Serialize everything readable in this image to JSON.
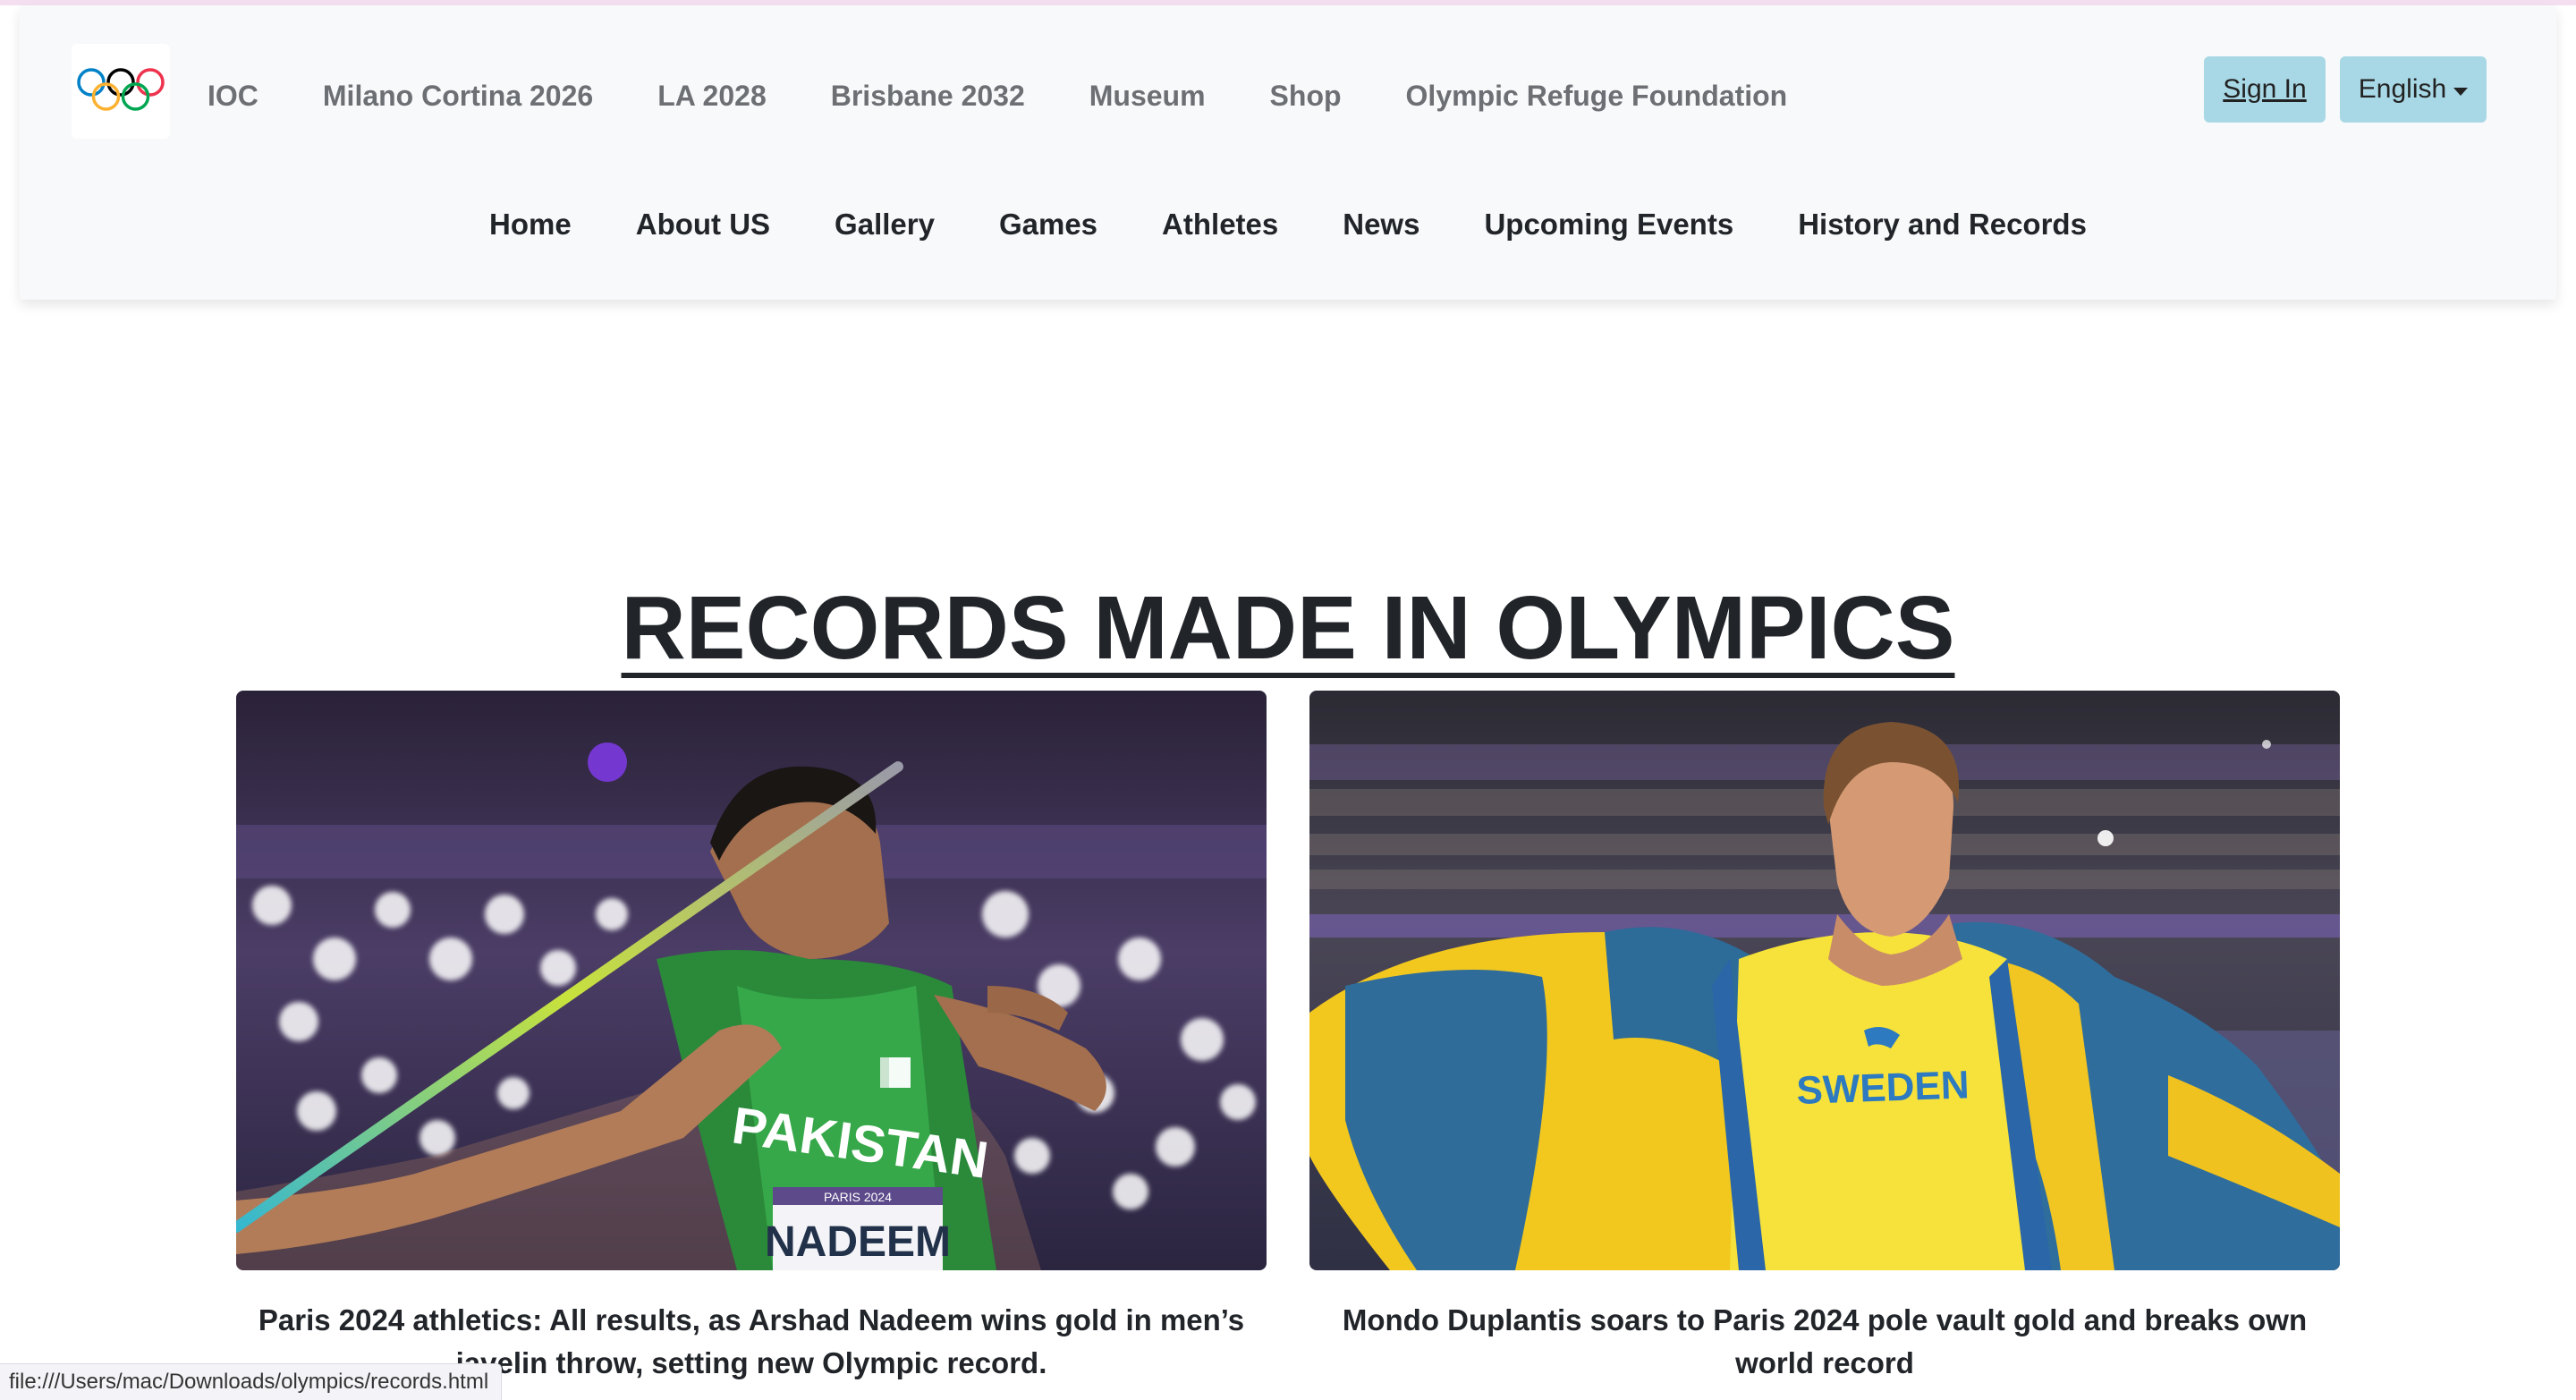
{
  "top_nav": {
    "items": [
      {
        "label": "IOC"
      },
      {
        "label": "Milano Cortina 2026"
      },
      {
        "label": "LA 2028"
      },
      {
        "label": "Brisbane 2032"
      },
      {
        "label": "Museum"
      },
      {
        "label": "Shop"
      },
      {
        "label": "Olympic Refuge Foundation"
      }
    ],
    "sign_in": "Sign In",
    "language": "English"
  },
  "main_nav": {
    "items": [
      {
        "label": "Home"
      },
      {
        "label": "About US"
      },
      {
        "label": "Gallery"
      },
      {
        "label": "Games"
      },
      {
        "label": "Athletes"
      },
      {
        "label": "News"
      },
      {
        "label": "Upcoming Events"
      },
      {
        "label": "History and Records"
      }
    ]
  },
  "page": {
    "title": "RECORDS MADE IN OLYMPICS"
  },
  "cards": [
    {
      "caption": "Paris 2024 athletics: All results, as Arshad Nadeem wins gold in men’s javelin throw, setting new Olympic record.",
      "shirt_text": "PAKISTAN",
      "bib_event": "PARIS 2024",
      "bib_name": "NADEEM"
    },
    {
      "caption": "Mondo Duplantis soars to Paris 2024 pole vault gold and breaks own world record",
      "shirt_text": "SWEDEN"
    }
  ],
  "status_bar": {
    "url": "file:///Users/mac/Downloads/olympics/records.html"
  },
  "colors": {
    "header_bg": "#f8f9fa",
    "button_bg": "#a8d8e6",
    "ring_blue": "#0081c8",
    "ring_yellow": "#fcb131",
    "ring_black": "#000000",
    "ring_green": "#00a651",
    "ring_red": "#ee334e"
  }
}
